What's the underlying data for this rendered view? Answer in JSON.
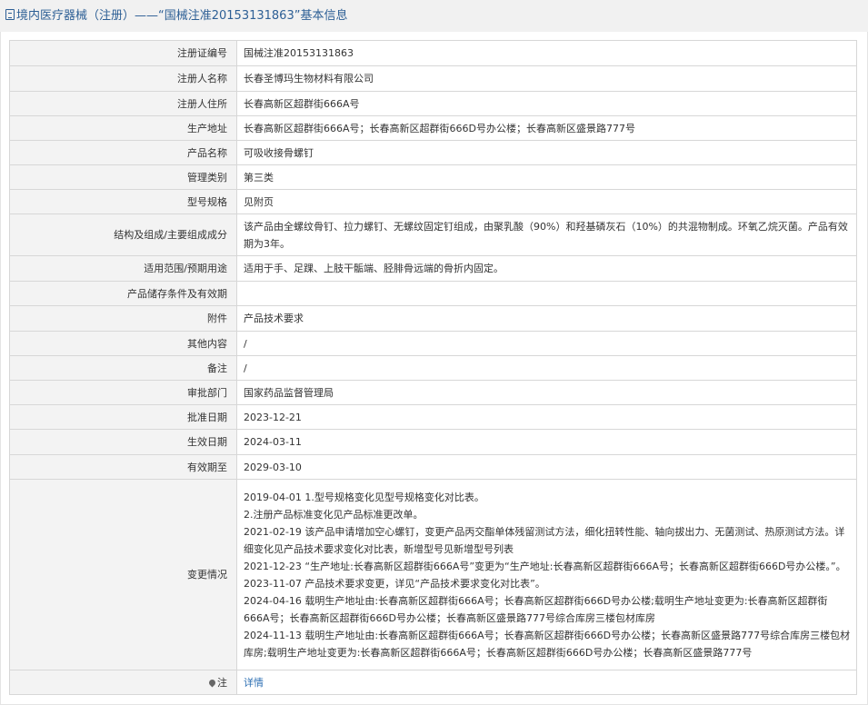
{
  "header": {
    "title": "境内医疗器械（注册）——“国械注准20153131863”基本信息"
  },
  "rows": [
    {
      "label": "注册证编号",
      "value": "国械注准20153131863"
    },
    {
      "label": "注册人名称",
      "value": "长春圣博玛生物材料有限公司"
    },
    {
      "label": "注册人住所",
      "value": "长春高新区超群街666A号"
    },
    {
      "label": "生产地址",
      "value": "长春高新区超群街666A号；长春高新区超群街666D号办公楼；长春高新区盛景路777号"
    },
    {
      "label": "产品名称",
      "value": "可吸收接骨螺钉"
    },
    {
      "label": "管理类别",
      "value": "第三类"
    },
    {
      "label": "型号规格",
      "value": "见附页"
    },
    {
      "label": "结构及组成/主要组成成分",
      "value": "该产品由全螺纹骨钉、拉力螺钉、无螺纹固定钉组成，由聚乳酸（90%）和羟基磷灰石（10%）的共混物制成。环氧乙烷灭菌。产品有效期为3年。"
    },
    {
      "label": "适用范围/预期用途",
      "value": "适用于手、足踝、上肢干骺端、胫腓骨远端的骨折内固定。"
    },
    {
      "label": "产品储存条件及有效期",
      "value": ""
    },
    {
      "label": "附件",
      "value": "产品技术要求"
    },
    {
      "label": "其他内容",
      "value": "/"
    },
    {
      "label": "备注",
      "value": "/"
    },
    {
      "label": "审批部门",
      "value": "国家药品监督管理局"
    },
    {
      "label": "批准日期",
      "value": "2023-12-21"
    },
    {
      "label": "生效日期",
      "value": "2024-03-11"
    },
    {
      "label": "有效期至",
      "value": "2029-03-10"
    }
  ],
  "changes": {
    "label": "变更情况",
    "lines": [
      "2019-04-01 1.型号规格变化见型号规格变化对比表。",
      "2.注册产品标准变化见产品标准更改单。",
      "2021-02-19 该产品申请增加空心螺钉，变更产品丙交酯单体残留测试方法，细化扭转性能、轴向拔出力、无菌测试、热原测试方法。详细变化见产品技术要求变化对比表，新增型号见新增型号列表",
      "2021-12-23 “生产地址:长春高新区超群街666A号”变更为“生产地址:长春高新区超群街666A号；长春高新区超群街666D号办公楼。”。",
      "2023-11-07 产品技术要求变更，详见“产品技术要求变化对比表”。",
      "2024-04-16 载明生产地址由:长春高新区超群街666A号；长春高新区超群街666D号办公楼;载明生产地址变更为:长春高新区超群街666A号；长春高新区超群街666D号办公楼；长春高新区盛景路777号综合库房三楼包材库房",
      "2024-11-13 载明生产地址由:长春高新区超群街666A号；长春高新区超群街666D号办公楼；长春高新区盛景路777号综合库房三楼包材库房;载明生产地址变更为:长春高新区超群街666A号；长春高新区超群街666D号办公楼；长春高新区盛景路777号"
    ]
  },
  "note": {
    "label": "注",
    "link_text": "详情",
    "icon": "pin-icon"
  },
  "colors": {
    "header_bg": "#f1f1f1",
    "title_text": "#2d5f95",
    "label_bg": "#f3f3f3",
    "border": "#d7d7d7",
    "link": "#2d6fb3"
  }
}
